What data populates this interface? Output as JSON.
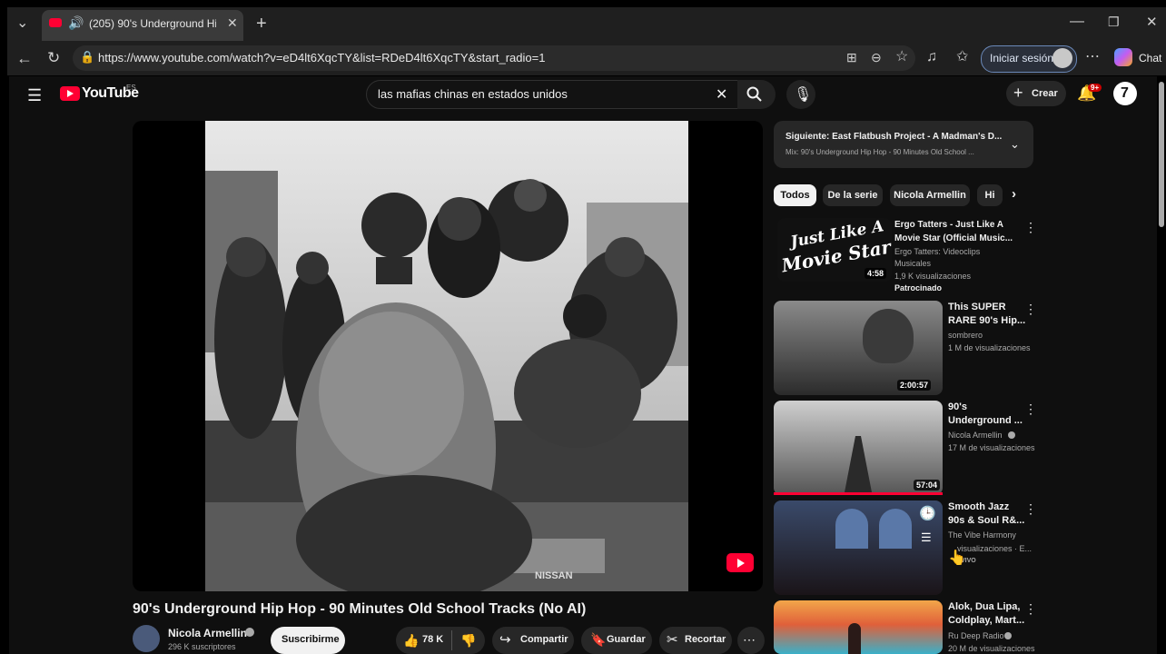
{
  "browser": {
    "tab_title": "(205) 90's Underground Hip H",
    "url": "https://www.youtube.com/watch?v=eD4lt6XqcTY&list=RDeD4lt6XqcTY&start_radio=1",
    "signin_label": "Iniciar sesión",
    "chat_label": "Chat"
  },
  "youtube": {
    "logo": "YouTube",
    "logo_region": "ES",
    "search_query": "las mafias chinas en estados unidos",
    "create_label": "Crear",
    "notif_badge": "9+"
  },
  "video": {
    "title": "90's Underground Hip Hop - 90 Minutes Old School Tracks (No AI)",
    "channel": "Nicola Armellin",
    "subscribers": "296 K suscriptores",
    "subscribe_label": "Suscribirme",
    "likes": "78 K",
    "share_label": "Compartir",
    "save_label": "Guardar",
    "clip_label": "Recortar",
    "car_brand": "NISSAN"
  },
  "sidebar": {
    "next_title": "Siguiente: East Flatbush Project - A Madman's D...",
    "next_mix": "Mix: 90's Underground Hip Hop - 90 Minutes Old School ...",
    "chips": [
      "Todos",
      "De la serie",
      "Nicola Armellin",
      "Hi"
    ],
    "recs": [
      {
        "title_1": "Ergo Tatters - Just Like A",
        "title_2": "Movie Star (Official Music...",
        "meta_1": "Ergo Tatters: Videoclips",
        "meta_2": "Musicales",
        "meta_3": "1,9 K visualizaciones",
        "meta_4": "Patrocinado",
        "duration": "4:58",
        "thumb_text_1": "Just Like A",
        "thumb_text_2": "Movie Star"
      },
      {
        "title_1": "This SUPER",
        "title_2": "RARE 90's Hip...",
        "meta_1": "sombrero",
        "meta_2": "1 M de visualizaciones",
        "duration": "2:00:57"
      },
      {
        "title_1": "90's",
        "title_2": "Underground ...",
        "meta_1": "Nicola Armellin",
        "meta_2": "17 M de visualizaciones",
        "duration": "57:04"
      },
      {
        "title_1": "Smooth Jazz",
        "title_2": "90s & Soul R&...",
        "meta_1": "The Vibe Harmony",
        "meta_2": "visualizaciones · E...",
        "meta_3": "VIVO"
      },
      {
        "title_1": "Alok, Dua Lipa,",
        "title_2": "Coldplay, Mart...",
        "meta_1": "Ru Deep Radio",
        "meta_2": "20 M de visualizaciones"
      }
    ]
  },
  "colors": {
    "accent_red": "#ff0033",
    "bg": "#0f0f0f",
    "pill": "#272727"
  }
}
